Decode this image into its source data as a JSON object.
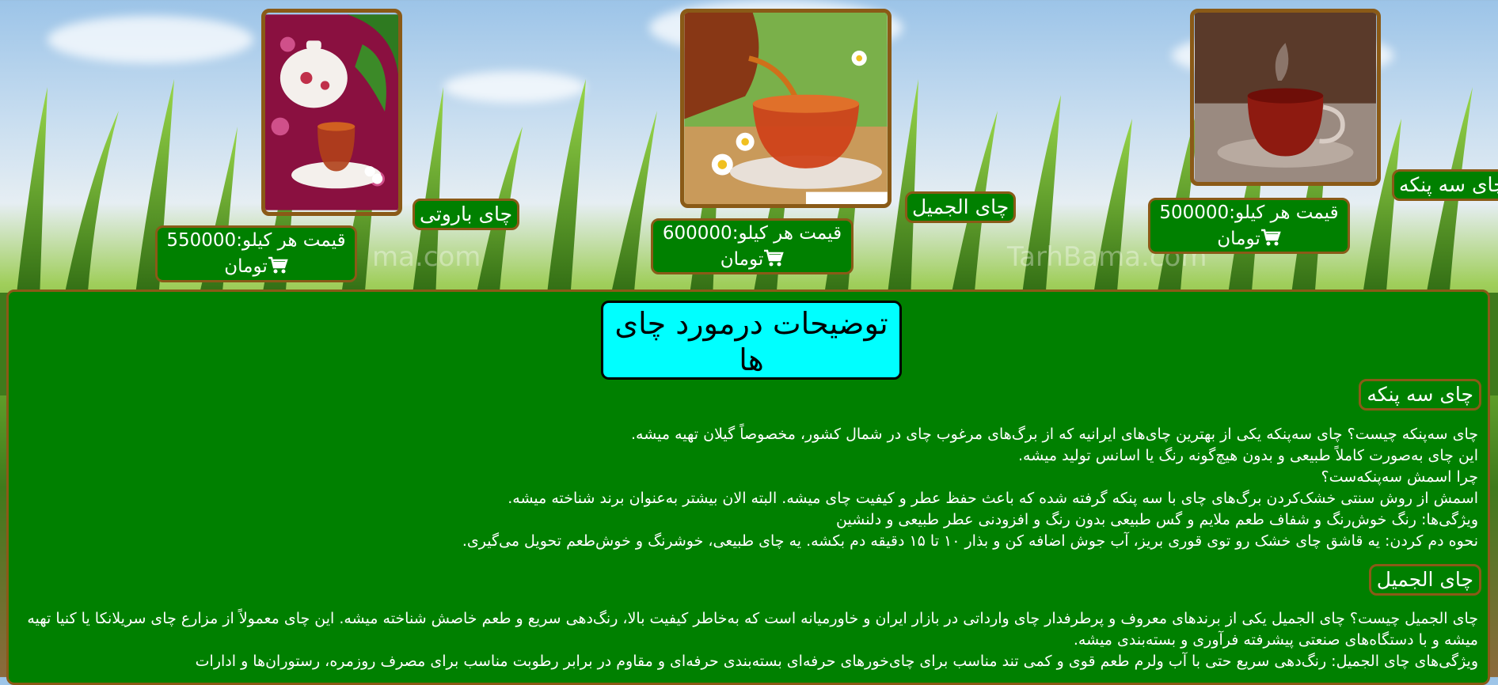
{
  "products": [
    {
      "name": "چای سه پنکه",
      "price_line": "قیمت هر کیلو:500000",
      "currency": "تومان",
      "image_icon": "tea-cup-photo-icon"
    },
    {
      "name": "چای الجمیل",
      "price_line": "قیمت هر کیلو:600000",
      "currency": "تومان",
      "image_icon": "tea-pouring-photo-icon"
    },
    {
      "name": "چای باروتی",
      "price_line": "قیمت هر کیلو:550000",
      "currency": "تومان",
      "image_icon": "teapot-photo-icon"
    }
  ],
  "watermarks": [
    "TarhBama.com",
    "ma.com"
  ],
  "description": {
    "title": "توضیحات درمورد چای ها",
    "sections": [
      {
        "heading": "چای سه پنکه",
        "lines": [
          "چای سه‌پنکه چیست؟ چای سه‌پنکه یکی از بهترین چای‌های ایرانیه که از برگ‌های مرغوب چای در شمال کشور، مخصوصاً گیلان تهیه میشه.",
          "این چای به‌صورت کاملاً طبیعی و بدون هیچ‌گونه رنگ یا اسانس تولید میشه.",
          "چرا اسمش سه‌پنکه‌ست؟",
          "اسمش از روش سنتی خشک‌کردن برگ‌های چای با سه پنکه گرفته شده که باعث حفظ عطر و کیفیت چای میشه. البته الان بیشتر به‌عنوان برند شناخته میشه.",
          "ویژگی‌ها: رنگ خوش‌رنگ و شفاف طعم ملایم و گس طبیعی بدون رنگ و افزودنی عطر طبیعی و دلنشین",
          "نحوه دم کردن: یه قاشق چای خشک رو توی قوری بریز، آب جوش اضافه کن و بذار ۱۰ تا ۱۵ دقیقه دم بکشه. یه چای طبیعی، خوشرنگ و خوش‌طعم تحویل می‌گیری."
        ]
      },
      {
        "heading": "چای الجمیل",
        "lines": [
          "چای الجمیل چیست؟ چای الجمیل یکی از برندهای معروف و پرطرفدار چای وارداتی در بازار ایران و خاورمیانه است که به‌خاطر کیفیت بالا، رنگ‌دهی سریع و طعم خاصش شناخته میشه. این چای معمولاً از مزارع چای سریلانکا یا کنیا تهیه میشه و با دستگاه‌های صنعتی پیشرفته فرآوری و بسته‌بندی میشه.",
          "ویژگی‌های چای الجمیل: رنگ‌دهی سریع حتی با آب ولرم طعم قوی و کمی تند مناسب برای چای‌خورهای حرفه‌ای بسته‌بندی حرفه‌ای و مقاوم در برابر رطوبت مناسب برای مصرف روزمره، رستوران‌ها و ادارات"
        ]
      }
    ]
  },
  "colors": {
    "panel_green": "#008000",
    "border_brown": "#8a5a17",
    "title_cyan": "#00ffff"
  }
}
